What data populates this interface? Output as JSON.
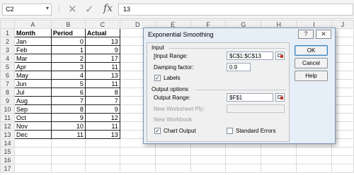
{
  "formula_bar": {
    "name_box": "C2",
    "name_box_dropdown_icon": "chevron-down-icon",
    "separator": "⋮",
    "cancel_icon": "close-icon",
    "enter_icon": "check-icon",
    "fx_label": "fx",
    "formula": "13"
  },
  "sheet": {
    "columns": [
      "A",
      "B",
      "C",
      "D",
      "E",
      "F",
      "G",
      "H",
      "I",
      "J"
    ],
    "rows": [
      {
        "n": "1",
        "a": "Month",
        "b": "Period",
        "c": "Actual"
      },
      {
        "n": "2",
        "a": "Jan",
        "b": "0",
        "c": "13"
      },
      {
        "n": "3",
        "a": "Feb",
        "b": "1",
        "c": "9"
      },
      {
        "n": "4",
        "a": "Mar",
        "b": "2",
        "c": "17"
      },
      {
        "n": "5",
        "a": "Apr",
        "b": "3",
        "c": "11"
      },
      {
        "n": "6",
        "a": "May",
        "b": "4",
        "c": "13"
      },
      {
        "n": "7",
        "a": "Jun",
        "b": "5",
        "c": "11"
      },
      {
        "n": "8",
        "a": "Jul",
        "b": "6",
        "c": "8"
      },
      {
        "n": "9",
        "a": "Aug",
        "b": "7",
        "c": "7"
      },
      {
        "n": "10",
        "a": "Sep",
        "b": "8",
        "c": "9"
      },
      {
        "n": "11",
        "a": "Oct",
        "b": "9",
        "c": "12"
      },
      {
        "n": "12",
        "a": "Nov",
        "b": "10",
        "c": "11"
      },
      {
        "n": "13",
        "a": "Dec",
        "b": "11",
        "c": "13"
      },
      {
        "n": "14",
        "a": "",
        "b": "",
        "c": ""
      },
      {
        "n": "15",
        "a": "",
        "b": "",
        "c": ""
      },
      {
        "n": "16",
        "a": "",
        "b": "",
        "c": ""
      },
      {
        "n": "17",
        "a": "",
        "b": "",
        "c": ""
      }
    ]
  },
  "dialog": {
    "title": "Exponential Smoothing",
    "help_button": "?",
    "close_button": "✕",
    "input_section": "Input",
    "input_range_label": "Input Range:",
    "input_range_value": "$C$1:$C$13",
    "damping_label": "Damping factor:",
    "damping_value": "0.9",
    "labels_checkbox": "Labels",
    "labels_checked": "✓",
    "output_section": "Output options",
    "output_range_label": "Output Range:",
    "output_range_value": "$F$1",
    "new_worksheet_label": "New Worksheet Ply:",
    "new_workbook_label": "New Workbook",
    "chart_output_label": "Chart Output",
    "chart_output_checked": "✓",
    "standard_errors_label": "Standard Errors",
    "ok_button": "OK",
    "cancel_button": "Cancel",
    "help_text_button": "Help"
  }
}
